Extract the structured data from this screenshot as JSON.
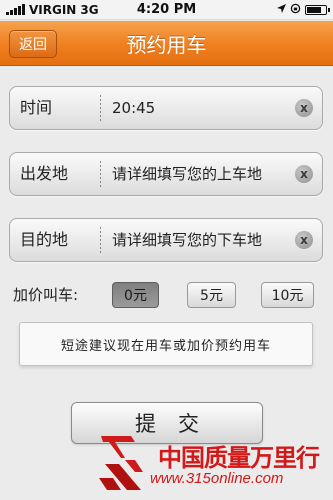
{
  "status_bar": {
    "carrier": "VIRGIN",
    "network": "3G",
    "time": "4:20 PM"
  },
  "nav": {
    "back_label": "返回",
    "title": "预约用车"
  },
  "form": {
    "time": {
      "label": "时间",
      "value": "20:45"
    },
    "origin": {
      "label": "出发地",
      "placeholder": "请详细填写您的上车地"
    },
    "destination": {
      "label": "目的地",
      "placeholder": "请详细填写您的下车地"
    },
    "clear_glyph": "x"
  },
  "price": {
    "label": "加价叫车:",
    "options": [
      "0元",
      "5元",
      "10元"
    ],
    "selected": "0元"
  },
  "hint": "短途建议现在用车或加价预约用车",
  "submit_label": "提交",
  "watermark": {
    "title": "中国质量万里行",
    "url": "www.315online.com"
  },
  "colors": {
    "nav_orange": "#ef7f1f",
    "watermark_red": "#d21818"
  },
  "icons": [
    "signal-icon",
    "location-arrow-icon",
    "lock-rotation-icon",
    "battery-icon",
    "clear-icon"
  ]
}
